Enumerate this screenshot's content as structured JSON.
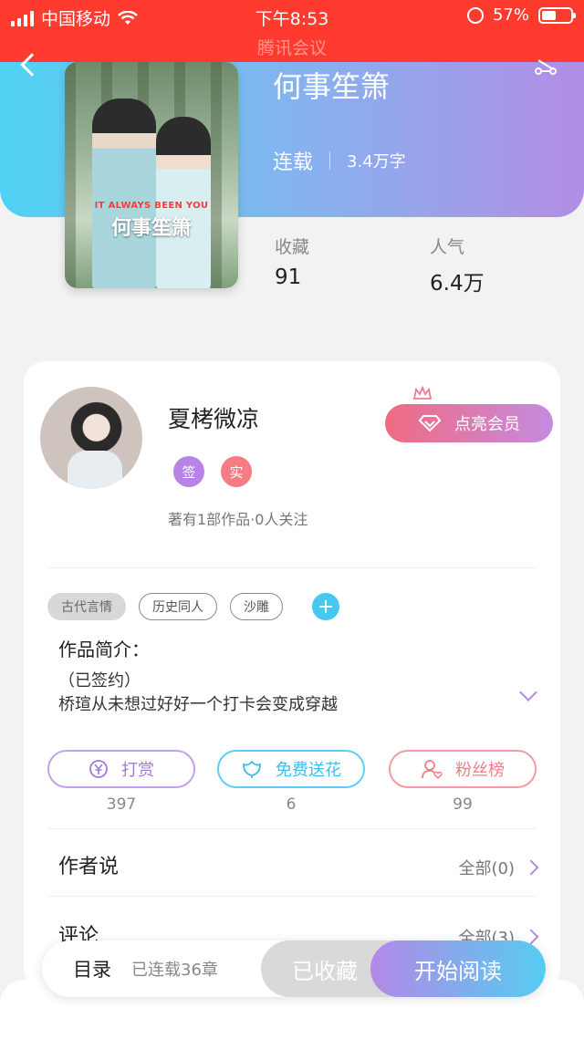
{
  "status_bar": {
    "carrier": "中国移动",
    "time": "下午8:53",
    "battery": "57%",
    "battery_level": 0.57,
    "overlay_app": "腾讯会议"
  },
  "book": {
    "title": "何事笙箫",
    "status": "连载",
    "word_count": "3.4万字",
    "cover_text_en": "IT ALWAYS BEEN YOU",
    "cover_text_cn": "何事笙箫",
    "stats": [
      {
        "label": "收藏",
        "value": "91"
      },
      {
        "label": "人气",
        "value": "6.4万"
      }
    ]
  },
  "author": {
    "name": "夏栲微凉",
    "vip_button": "点亮会员",
    "badges": [
      "签",
      "实"
    ],
    "meta": "著有1部作品·0人关注"
  },
  "tags": [
    "古代言情",
    "历史同人",
    "沙雕"
  ],
  "intro": {
    "title": "作品简介：",
    "lines": [
      "（已签约）",
      "桥瑄从未想过好好一个打卡会变成穿越"
    ]
  },
  "actions": [
    {
      "label": "打赏",
      "count": "397",
      "icon": "yuan-coin-icon"
    },
    {
      "label": "免费送花",
      "count": "6",
      "icon": "flower-icon"
    },
    {
      "label": "粉丝榜",
      "count": "99",
      "icon": "fan-person-icon"
    }
  ],
  "sections": [
    {
      "title": "作者说",
      "link": "全部(0)"
    },
    {
      "title": "评论",
      "link": "全部(3)"
    }
  ],
  "bottom_bar": {
    "toc": "目录",
    "chapters": "已连载36章",
    "favorite": "已收藏",
    "read": "开始阅读"
  },
  "colors": {
    "status_bar": "#ff3b30",
    "gradient_start": "#4fd3f5",
    "gradient_end": "#b28ee6"
  }
}
